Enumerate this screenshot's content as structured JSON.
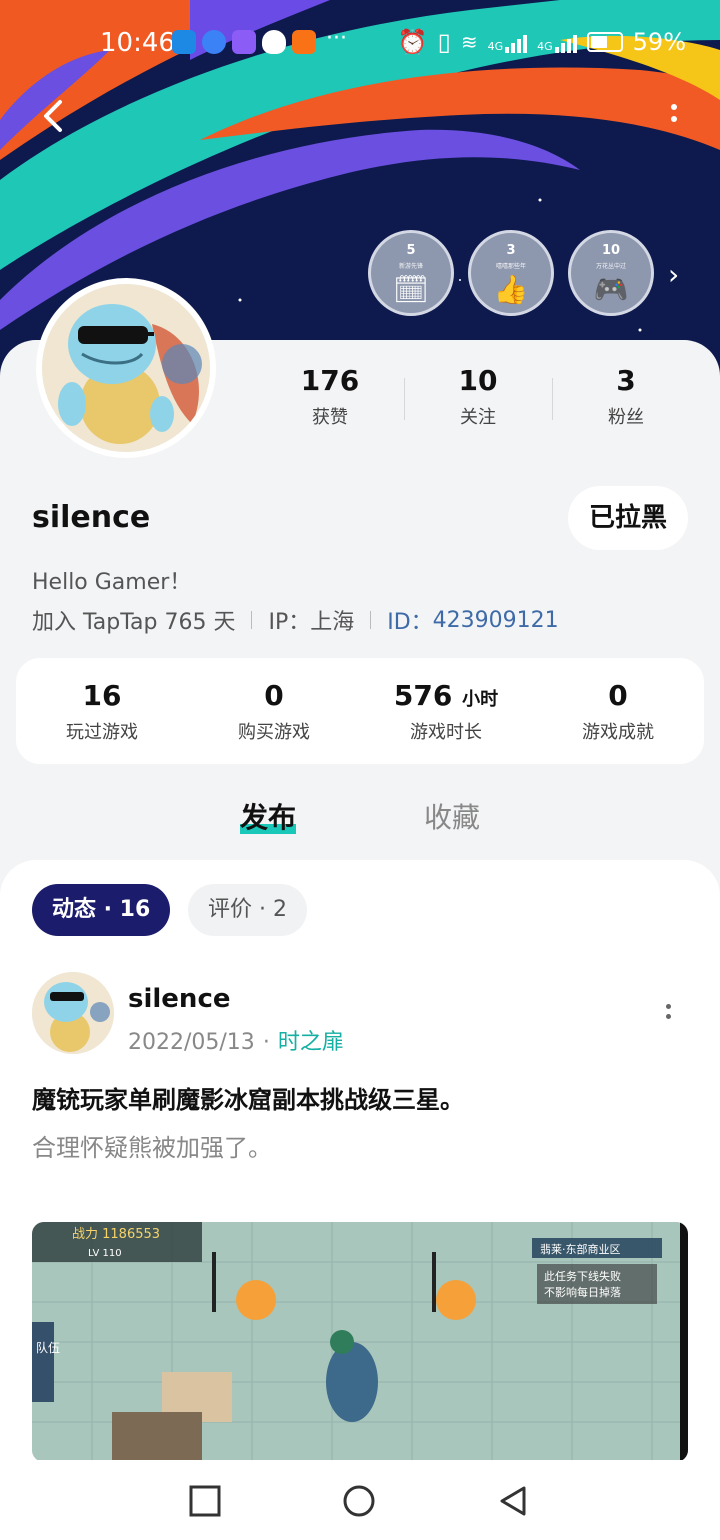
{
  "status_bar": {
    "time": "10:46",
    "battery": "59%",
    "more": "···",
    "net1": "4G",
    "net2": "4G"
  },
  "header": {
    "back_icon": "chevron-left-icon",
    "more_icon": "more-vertical-icon",
    "badges": [
      {
        "num": "5",
        "caption": "新游先锋",
        "icon": "game-calendar-icon"
      },
      {
        "num": "3",
        "caption": "嘻嘻那些年",
        "icon": "thumbs-up-icon"
      },
      {
        "num": "10",
        "caption": "万花丛中过",
        "icon": "gamepad-icon"
      }
    ]
  },
  "profile": {
    "stats": [
      {
        "value": "176",
        "label": "获赞"
      },
      {
        "value": "10",
        "label": "关注"
      },
      {
        "value": "3",
        "label": "粉丝"
      }
    ],
    "username": "silence",
    "blocked_label": "已拉黑",
    "bio": "Hello Gamer！",
    "joined": "加入 TapTap 765 天",
    "ip": "IP：上海",
    "id_label": "ID：",
    "id_value": "423909121"
  },
  "game_stats": [
    {
      "value": "16",
      "unit": "",
      "label": "玩过游戏"
    },
    {
      "value": "0",
      "unit": "",
      "label": "购买游戏"
    },
    {
      "value": "576",
      "unit": "小时",
      "label": "游戏时长"
    },
    {
      "value": "0",
      "unit": "",
      "label": "游戏成就"
    }
  ],
  "tabs": {
    "publish": "发布",
    "favorites": "收藏"
  },
  "feed": {
    "chips": [
      {
        "label": "动态  · 16"
      },
      {
        "label": "评价  · 2"
      }
    ],
    "post": {
      "user": "silence",
      "date": "2022/05/13",
      "dot": "·",
      "game": "时之扉",
      "title": "魔铳玩家单刷魔影冰窟副本挑战级三星。",
      "body": "合理怀疑熊被加强了。",
      "image_texts": {
        "power": "战力 1186553",
        "level": "LV 110",
        "location": "翡莱·东部商业区",
        "task1": "此任务下线失败",
        "task2": "不影响每日掉落",
        "side": "队伍"
      }
    }
  },
  "navbar": {
    "recent_icon": "square-icon",
    "home_icon": "circle-icon",
    "back_icon": "triangle-back-icon"
  }
}
